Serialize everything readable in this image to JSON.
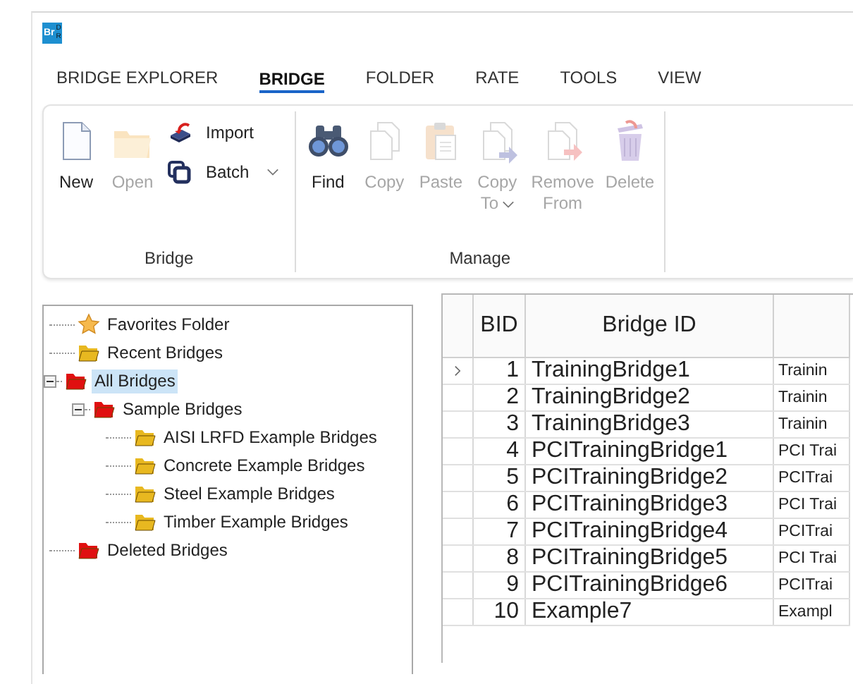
{
  "logo": {
    "left": "Br",
    "right": "DR"
  },
  "tabs": [
    {
      "label": "BRIDGE EXPLORER",
      "selected": false
    },
    {
      "label": "BRIDGE",
      "selected": true
    },
    {
      "label": "FOLDER",
      "selected": false
    },
    {
      "label": "RATE",
      "selected": false
    },
    {
      "label": "TOOLS",
      "selected": false
    },
    {
      "label": "VIEW",
      "selected": false
    }
  ],
  "ribbon": {
    "groups": [
      {
        "label": "Bridge",
        "items": [
          {
            "kind": "large",
            "lines": [
              "New"
            ],
            "disabled": false
          },
          {
            "kind": "large",
            "lines": [
              "Open"
            ],
            "disabled": true
          },
          {
            "kind": "stack",
            "items": [
              {
                "label": "Import",
                "dropdown": false
              },
              {
                "label": "Batch",
                "dropdown": true
              }
            ]
          }
        ]
      },
      {
        "label": "Manage",
        "items": [
          {
            "kind": "large",
            "lines": [
              "Find"
            ],
            "disabled": false
          },
          {
            "kind": "large",
            "lines": [
              "Copy"
            ],
            "disabled": true
          },
          {
            "kind": "large",
            "lines": [
              "Paste"
            ],
            "disabled": true
          },
          {
            "kind": "large",
            "lines": [
              "Copy",
              "To"
            ],
            "dropdown": true,
            "disabled": true
          },
          {
            "kind": "large",
            "lines": [
              "Remove",
              "From"
            ],
            "disabled": true
          },
          {
            "kind": "large",
            "lines": [
              "Delete"
            ],
            "disabled": true
          }
        ]
      }
    ]
  },
  "tree": [
    {
      "label": "Favorites Folder",
      "kind": "star",
      "selected": false
    },
    {
      "label": "Recent Bridges",
      "kind": "folder",
      "color": "#e8b820",
      "selected": false
    },
    {
      "label": "All Bridges",
      "kind": "folder",
      "color": "#e01010",
      "selected": true,
      "expanded": true,
      "children": [
        {
          "label": "Sample Bridges",
          "kind": "folder",
          "color": "#e01010",
          "selected": false,
          "expanded": true,
          "children": [
            {
              "label": "AISI LRFD Example Bridges",
              "kind": "folder",
              "color": "#e8b820",
              "selected": false
            },
            {
              "label": "Concrete Example Bridges",
              "kind": "folder",
              "color": "#e8b820",
              "selected": false
            },
            {
              "label": "Steel Example Bridges",
              "kind": "folder",
              "color": "#e8b820",
              "selected": false
            },
            {
              "label": "Timber Example Bridges",
              "kind": "folder",
              "color": "#e8b820",
              "selected": false
            }
          ]
        }
      ]
    },
    {
      "label": "Deleted Bridges",
      "kind": "folder",
      "color": "#e01010",
      "selected": false
    }
  ],
  "table": {
    "columns": [
      "BID",
      "Bridge ID"
    ],
    "rows": [
      {
        "selected": true,
        "cells": [
          "1",
          "TrainingBridge1",
          "Trainin"
        ]
      },
      {
        "selected": false,
        "cells": [
          "2",
          "TrainingBridge2",
          "Trainin"
        ]
      },
      {
        "selected": false,
        "cells": [
          "3",
          "TrainingBridge3",
          "Trainin"
        ]
      },
      {
        "selected": false,
        "cells": [
          "4",
          "PCITrainingBridge1",
          "PCI Trai"
        ]
      },
      {
        "selected": false,
        "cells": [
          "5",
          "PCITrainingBridge2",
          "PCITrai"
        ]
      },
      {
        "selected": false,
        "cells": [
          "6",
          "PCITrainingBridge3",
          "PCI Trai"
        ]
      },
      {
        "selected": false,
        "cells": [
          "7",
          "PCITrainingBridge4",
          "PCITrai"
        ]
      },
      {
        "selected": false,
        "cells": [
          "8",
          "PCITrainingBridge5",
          "PCI Trai"
        ]
      },
      {
        "selected": false,
        "cells": [
          "9",
          "PCITrainingBridge6",
          "PCITrai"
        ]
      },
      {
        "selected": false,
        "cells": [
          "10",
          "Example7",
          "Exampl"
        ]
      }
    ]
  }
}
